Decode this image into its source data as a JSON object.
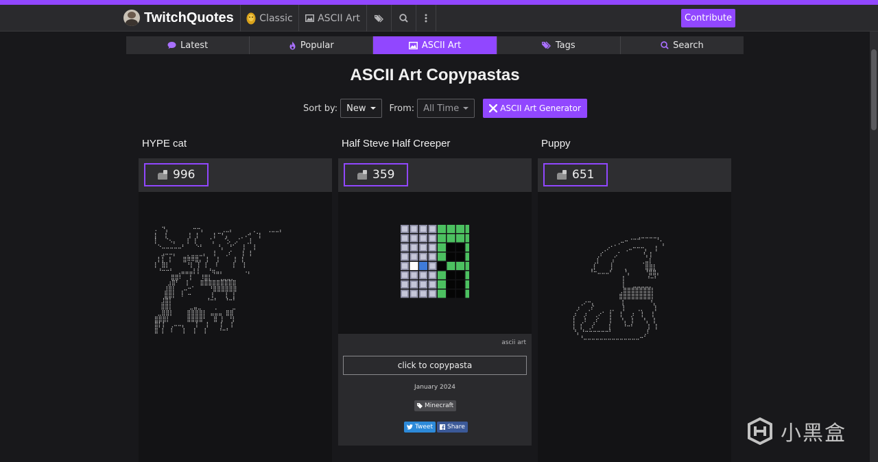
{
  "site": {
    "brand": "TwitchQuotes",
    "nav": {
      "classic": "Classic",
      "ascii_art": "ASCII Art",
      "tags_icon": "tag-icon",
      "search_icon": "search-icon",
      "more_icon": "ellipsis-vertical-icon"
    },
    "contribute_label": "Contribute",
    "accent_color": "#9147ff"
  },
  "tabs": [
    {
      "label": "Latest",
      "icon": "comment-icon",
      "active": false
    },
    {
      "label": "Popular",
      "icon": "fire-icon",
      "active": false
    },
    {
      "label": "ASCII Art",
      "icon": "image-icon",
      "active": true
    },
    {
      "label": "Tags",
      "icon": "tags-icon",
      "active": false
    },
    {
      "label": "Search",
      "icon": "search-icon",
      "active": false
    }
  ],
  "page": {
    "title": "ASCII Art Copypastas",
    "sort_label": "Sort by:",
    "sort_value": "New",
    "from_label": "From:",
    "from_value": "All Time",
    "generator_label": "ASCII Art Generator"
  },
  "cards": [
    {
      "title": "HYPE cat",
      "votes": "996"
    },
    {
      "title": "Half Steve Half Creeper",
      "votes": "359",
      "category": "ascii art",
      "copy_label": "click to copypasta",
      "date": "January 2024",
      "tag": "Minecraft",
      "tweet_label": "Tweet",
      "share_label": "Share"
    },
    {
      "title": "Puppy",
      "votes": "651"
    }
  ],
  "watermark": "小黑盒"
}
